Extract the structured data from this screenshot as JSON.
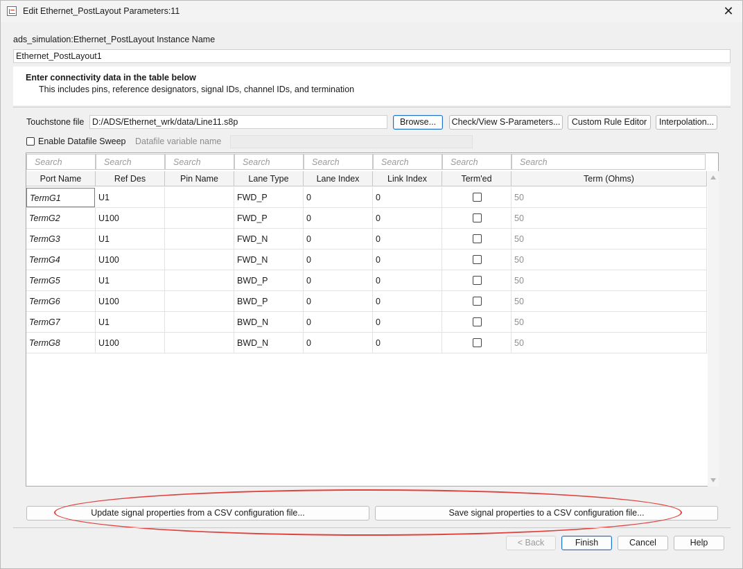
{
  "window": {
    "title": "Edit Ethernet_PostLayout Parameters:11"
  },
  "instance": {
    "label": "ads_simulation:Ethernet_PostLayout Instance Name",
    "value": "Ethernet_PostLayout1"
  },
  "info": {
    "title": "Enter connectivity data in the table below",
    "subtitle": "This includes pins, reference designators, signal IDs, channel IDs, and termination"
  },
  "touchstone": {
    "label": "Touchstone file",
    "value": "D:/ADS/Ethernet_wrk/data/Line11.s8p",
    "browse": "Browse...",
    "check_view": "Check/View S-Parameters...",
    "custom_rule": "Custom Rule Editor",
    "interpolation": "Interpolation..."
  },
  "sweep": {
    "enable_label": "Enable Datafile Sweep",
    "enable_checked": false,
    "variable_label": "Datafile variable name",
    "variable_value": ""
  },
  "table": {
    "search_placeholder": "Search",
    "columns": [
      "Port Name",
      "Ref Des",
      "Pin Name",
      "Lane Type",
      "Lane Index",
      "Link Index",
      "Term'ed",
      "Term (Ohms)"
    ],
    "rows": [
      {
        "port": "TermG1",
        "ref": "U1",
        "pin": "",
        "lane_type": "FWD_P",
        "lane_index": "0",
        "link_index": "0",
        "termed": false,
        "term": "50"
      },
      {
        "port": "TermG2",
        "ref": "U100",
        "pin": "",
        "lane_type": "FWD_P",
        "lane_index": "0",
        "link_index": "0",
        "termed": false,
        "term": "50"
      },
      {
        "port": "TermG3",
        "ref": "U1",
        "pin": "",
        "lane_type": "FWD_N",
        "lane_index": "0",
        "link_index": "0",
        "termed": false,
        "term": "50"
      },
      {
        "port": "TermG4",
        "ref": "U100",
        "pin": "",
        "lane_type": "FWD_N",
        "lane_index": "0",
        "link_index": "0",
        "termed": false,
        "term": "50"
      },
      {
        "port": "TermG5",
        "ref": "U1",
        "pin": "",
        "lane_type": "BWD_P",
        "lane_index": "0",
        "link_index": "0",
        "termed": false,
        "term": "50"
      },
      {
        "port": "TermG6",
        "ref": "U100",
        "pin": "",
        "lane_type": "BWD_P",
        "lane_index": "0",
        "link_index": "0",
        "termed": false,
        "term": "50"
      },
      {
        "port": "TermG7",
        "ref": "U1",
        "pin": "",
        "lane_type": "BWD_N",
        "lane_index": "0",
        "link_index": "0",
        "termed": false,
        "term": "50"
      },
      {
        "port": "TermG8",
        "ref": "U100",
        "pin": "",
        "lane_type": "BWD_N",
        "lane_index": "0",
        "link_index": "0",
        "termed": false,
        "term": "50"
      }
    ]
  },
  "csv": {
    "update": "Update signal properties from a CSV configuration file...",
    "save": "Save signal properties to a CSV configuration file..."
  },
  "footer": {
    "back": "< Back",
    "finish": "Finish",
    "cancel": "Cancel",
    "help": "Help"
  },
  "colors": {
    "highlight": "#e0413e",
    "primary_border": "#1f6fc5"
  }
}
